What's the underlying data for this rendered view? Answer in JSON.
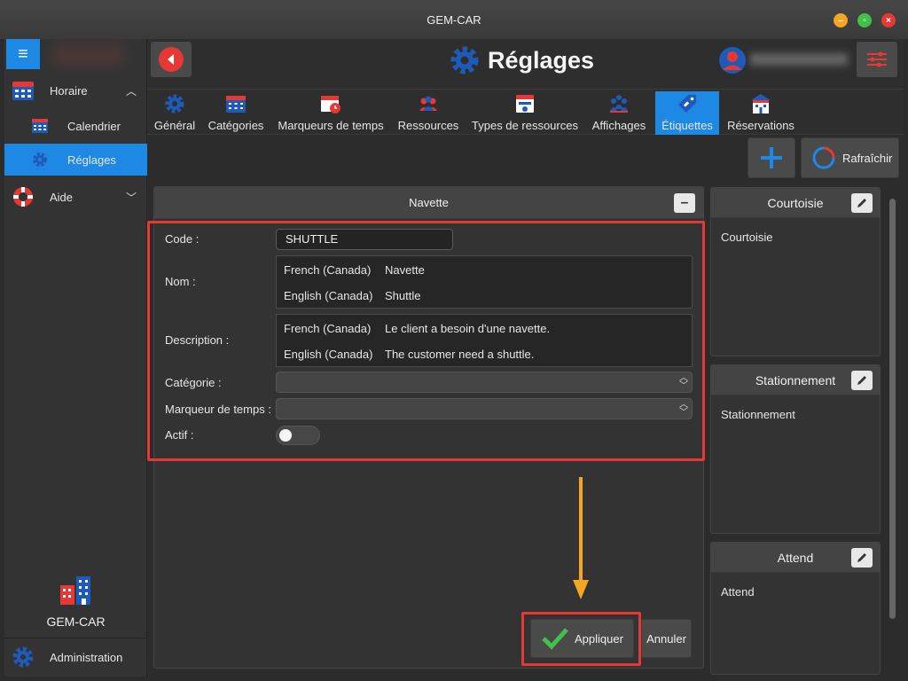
{
  "window": {
    "title": "GEM-CAR"
  },
  "sidebar": {
    "items": [
      {
        "label": "Horaire",
        "icon": "calendar-icon",
        "chevron": "^"
      },
      {
        "label": "Calendrier",
        "icon": "calendar-small-icon"
      },
      {
        "label": "Réglages",
        "icon": "gear-icon"
      },
      {
        "label": "Aide",
        "icon": "lifebuoy-icon",
        "chevron": "v"
      }
    ],
    "brand_name": "GEM-CAR",
    "admin_label": "Administration"
  },
  "header": {
    "title": "Réglages"
  },
  "tabs": [
    {
      "label": "Général",
      "icon": "gear-icon"
    },
    {
      "label": "Catégories",
      "icon": "calendar-grid-icon"
    },
    {
      "label": "Marqueurs de temps",
      "icon": "calendar-clock-icon"
    },
    {
      "label": "Ressources",
      "icon": "people-icon"
    },
    {
      "label": "Types de ressources",
      "icon": "id-card-icon"
    },
    {
      "label": "Affichages",
      "icon": "group-icon"
    },
    {
      "label": "Étiquettes",
      "icon": "tag-icon",
      "active": true
    },
    {
      "label": "Réservations",
      "icon": "building-icon"
    }
  ],
  "toolbar": {
    "refresh_label": "Rafraîchir"
  },
  "form": {
    "card_title": "Navette",
    "code_label": "Code :",
    "code_value": "SHUTTLE",
    "name_label": "Nom :",
    "name_values": [
      {
        "lang": "French (Canada)",
        "value": "Navette"
      },
      {
        "lang": "English (Canada)",
        "value": "Shuttle"
      }
    ],
    "description_label": "Description :",
    "description_values": [
      {
        "lang": "French (Canada)",
        "value": "Le client a besoin d'une navette."
      },
      {
        "lang": "English (Canada)",
        "value": "The customer need a shuttle."
      }
    ],
    "category_label": "Catégorie :",
    "time_marker_label": "Marqueur de temps :",
    "active_label": "Actif :",
    "active_value": false,
    "apply_label": "Appliquer",
    "cancel_label": "Annuler"
  },
  "labels_list": [
    {
      "title": "Courtoisie",
      "body": "Courtoisie"
    },
    {
      "title": "Stationnement",
      "body": "Stationnement"
    },
    {
      "title": "Attend",
      "body": "Attend"
    }
  ],
  "colors": {
    "accent": "#1e88e5",
    "highlight": "#e53935",
    "annotation_arrow": "#f5a623",
    "check": "#43c04a"
  }
}
